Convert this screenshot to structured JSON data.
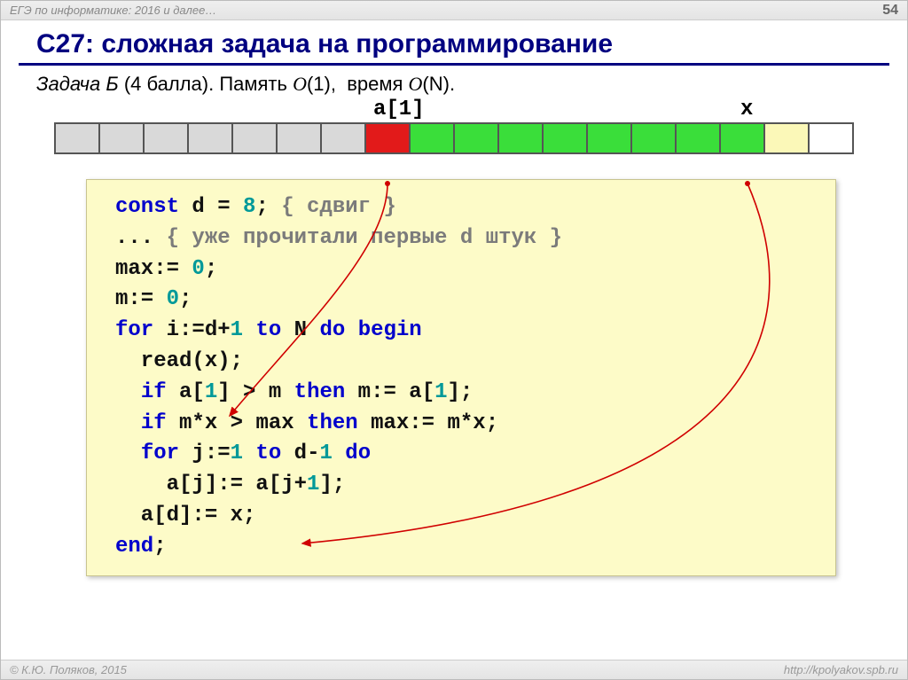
{
  "header": {
    "left": "ЕГЭ по информатике: 2016 и далее…",
    "page_number": "54"
  },
  "title": "C27: сложная задача на программирование",
  "subtitle": {
    "task": "Задача Б",
    "points": "(4 балла).",
    "memory_label": "Память",
    "memory_o": "O",
    "memory_v": "(1),",
    "time_label": "время",
    "time_o": "O",
    "time_v": "(N)."
  },
  "labels": {
    "a1": "a[1]",
    "x": "x"
  },
  "cells": {
    "layout": "7 grey, 1 red, 8 green, 1 yellow, 1 white"
  },
  "code": {
    "l1a": "const",
    "l1b": " d = ",
    "l1c": "8",
    "l1d": "; ",
    "l1e": "{ сдвиг }",
    "l2a": "... ",
    "l2b": "{ уже прочитали первые d штук }",
    "l3": "max:= ",
    "l3n": "0",
    "l3e": ";",
    "l4": "m:= ",
    "l4n": "0",
    "l4e": ";",
    "l5a": "for",
    "l5b": " i:=d+",
    "l5n": "1",
    "l5c": " ",
    "l5d": "to",
    "l5e": " N ",
    "l5f": "do begin",
    "l6": "  read(x);",
    "l7a": "  ",
    "l7b": "if",
    "l7c": " a[",
    "l7n": "1",
    "l7d": "] > m ",
    "l7e": "then",
    "l7f": " m:= a[",
    "l7n2": "1",
    "l7g": "];",
    "l8a": "  ",
    "l8b": "if",
    "l8c": " m*x > max ",
    "l8d": "then",
    "l8e": " max:= m*x;",
    "l9a": "  ",
    "l9b": "for",
    "l9c": " j:=",
    "l9n": "1",
    "l9d": " ",
    "l9e": "to",
    "l9f": " d-",
    "l9n2": "1",
    "l9g": " ",
    "l9h": "do",
    "l10a": "    a[j]:= a[j+",
    "l10n": "1",
    "l10b": "];",
    "l11": "  a[d]:= x;",
    "l12": "end",
    "l12e": ";"
  },
  "footer": {
    "left": "© К.Ю. Поляков, 2015",
    "right": "http://kpolyakov.spb.ru"
  }
}
